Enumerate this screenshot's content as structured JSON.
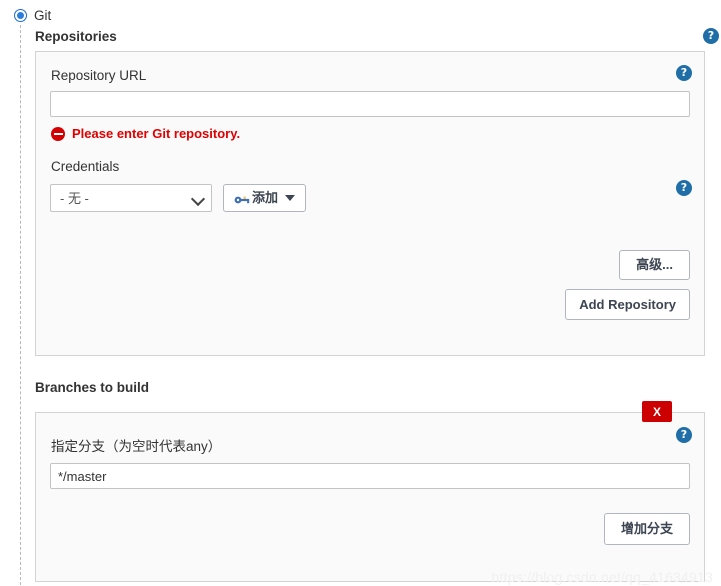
{
  "scm": {
    "selected_label": "Git",
    "radio_state": "selected",
    "accent_color": "#2b7ddb"
  },
  "repositories": {
    "section_title": "Repositories",
    "help_icon": "help-icon",
    "repository_url": {
      "label": "Repository URL",
      "value": "",
      "placeholder": "",
      "help_icon": "help-icon",
      "error": {
        "icon": "error-circle-icon",
        "text": "Please enter Git repository.",
        "color": "#e10000"
      }
    },
    "credentials": {
      "label": "Credentials",
      "selected_option": "- 无 -",
      "options": [
        "- 无 -"
      ],
      "help_icon": "help-icon",
      "add_button": {
        "label": "添加",
        "icon": "key-icon",
        "caret": "caret-down-icon"
      }
    },
    "advanced_button": "高级...",
    "add_repository_button": "Add Repository"
  },
  "branches": {
    "section_title": "Branches to build",
    "delete_button": "X",
    "help_icon": "help-icon",
    "branch_specifier": {
      "label": "指定分支（为空时代表any）",
      "value": "*/master",
      "placeholder": ""
    },
    "add_branch_button": "增加分支"
  },
  "watermark": {
    "text": "https://blog.csdn.net/qq_41634913"
  }
}
